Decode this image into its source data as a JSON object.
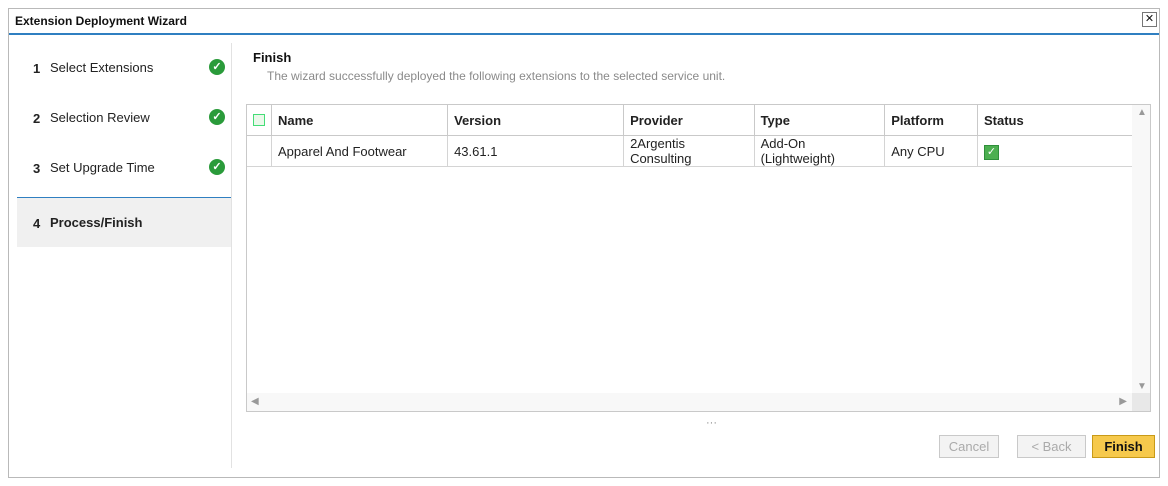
{
  "dialog": {
    "title": "Extension Deployment Wizard",
    "close_glyph": "✕"
  },
  "steps": [
    {
      "number": "1",
      "label": "Select Extensions",
      "done": true
    },
    {
      "number": "2",
      "label": "Selection Review",
      "done": true
    },
    {
      "number": "3",
      "label": "Set Upgrade Time",
      "done": true
    },
    {
      "number": "4",
      "label": "Process/Finish",
      "done": false
    }
  ],
  "finish": {
    "heading": "Finish",
    "message": "The wizard successfully deployed the following extensions to the selected service unit."
  },
  "table": {
    "columns": [
      "Name",
      "Version",
      "Provider",
      "Type",
      "Platform",
      "Status"
    ],
    "rows": [
      {
        "name": "Apparel And Footwear",
        "version": "43.61.1",
        "provider": "2Argentis Consulting",
        "type": "Add-On (Lightweight)",
        "platform": "Any CPU",
        "status": "✓"
      }
    ]
  },
  "resize_handle": "···",
  "buttons": {
    "cancel": "Cancel",
    "back": "< Back",
    "finish": "Finish"
  },
  "colors": {
    "accent": "#2f7fc1",
    "success": "#2a9b3a",
    "primary_button": "#f6c94c"
  }
}
